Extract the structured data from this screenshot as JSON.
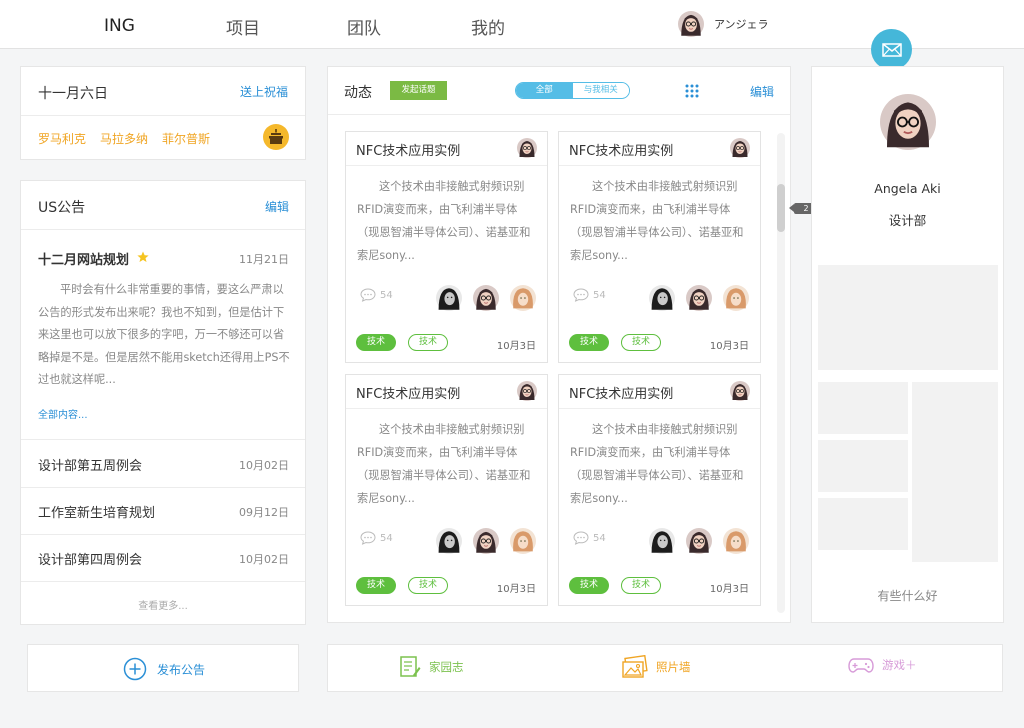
{
  "nav": {
    "logo": "ING",
    "items": [
      "项目",
      "团队",
      "我的"
    ],
    "user_name": "アンジェラ"
  },
  "greeting": {
    "date": "十一月六日",
    "action": "送上祝福",
    "names": [
      "罗马利克",
      "马拉多纳",
      "菲尔普斯"
    ]
  },
  "notice": {
    "title": "US公告",
    "edit": "编辑",
    "featured": {
      "title": "十二月网站规划",
      "date": "11月21日",
      "body": "平时会有什么非常重要的事情，要这么严肃以公告的形式发布出来呢？我也不知到，但是估计下来这里也可以放下很多的字吧，万一不够还可以省略掉是不是。但是居然不能用sketch还得用上PS不过也就这样呢...",
      "more": "全部内容..."
    },
    "rows": [
      {
        "title": "设计部第五周例会",
        "date": "10月02日"
      },
      {
        "title": "工作室新生培育规划",
        "date": "09月12日"
      },
      {
        "title": "设计部第四周例会",
        "date": "10月02日"
      }
    ],
    "see_more": "查看更多..."
  },
  "feed": {
    "title": "动态",
    "start_topic": "发起话题",
    "filter_all": "全部",
    "filter_related": "与我相关",
    "edit": "编辑",
    "scroll_badge": "2",
    "posts": [
      {
        "title": "NFC技术应用实例",
        "body": "这个技术由非接触式射频识别RFID演变而来，由飞利浦半导体（现恩智浦半导体公司）、诺基亚和索尼sony...",
        "comments": "54",
        "tag1": "技术",
        "tag2": "技术",
        "date": "10月3日"
      },
      {
        "title": "NFC技术应用实例",
        "body": "这个技术由非接触式射频识别RFID演变而来，由飞利浦半导体（现恩智浦半导体公司）、诺基亚和索尼sony...",
        "comments": "54",
        "tag1": "技术",
        "tag2": "技术",
        "date": "10月3日"
      },
      {
        "title": "NFC技术应用实例",
        "body": "这个技术由非接触式射频识别RFID演变而来，由飞利浦半导体（现恩智浦半导体公司）、诺基亚和索尼sony...",
        "comments": "54",
        "tag1": "技术",
        "tag2": "技术",
        "date": "10月3日"
      },
      {
        "title": "NFC技术应用实例",
        "body": "这个技术由非接触式射频识别RFID演变而来，由飞利浦半导体（现恩智浦半导体公司）、诺基亚和索尼sony...",
        "comments": "54",
        "tag1": "技术",
        "tag2": "技术",
        "date": "10月3日"
      }
    ]
  },
  "profile": {
    "name": "Angela Aki",
    "dept": "设计部",
    "footer": "有些什么好"
  },
  "bottom": {
    "publish": "发布公告",
    "journal": "家园志",
    "photos": "照片墙",
    "games": "游戏＋"
  },
  "colors": {
    "accent_blue": "#2a8fd6",
    "tag_green": "#5ebf3e",
    "highlight_orange": "#f0a524",
    "mail_cyan": "#45b7d9"
  }
}
